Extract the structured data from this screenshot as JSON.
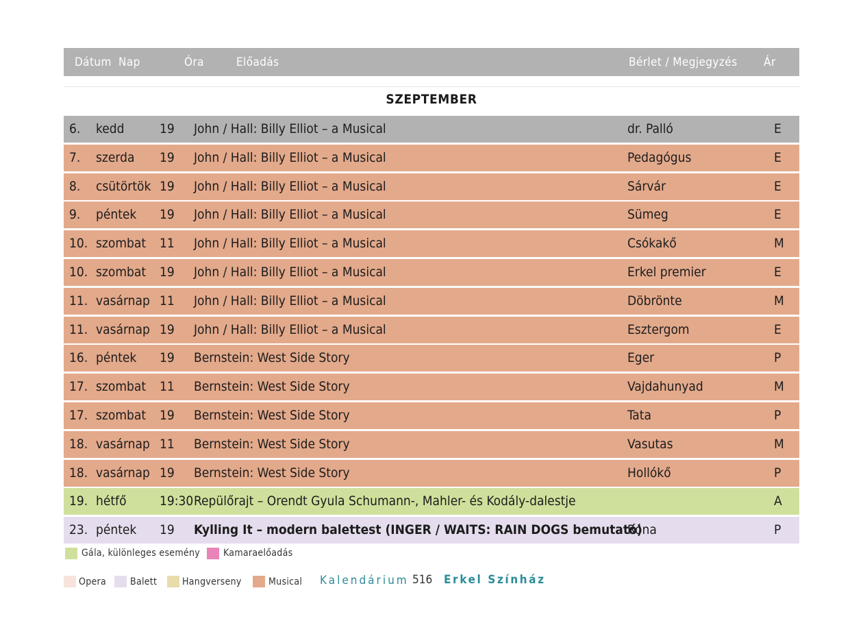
{
  "header": {
    "date": "Dátum",
    "day": "Nap",
    "time": "Óra",
    "performance": "Előadás",
    "subscription": "Bérlet / Megjegyzés",
    "price": "Ár"
  },
  "month": "SZEPTEMBER",
  "colors": {
    "header": "#b2b2b2",
    "grey_row": "#b2b2b2",
    "musical": "#e3a98b",
    "gala": "#cfe09c",
    "ballet": "#e5dded",
    "opera": "#f7e3dc",
    "concert": "#e8dcab",
    "chamber": "#e884b8",
    "accent_teal": "#2b8c98"
  },
  "rows": [
    {
      "date": "6.",
      "day": "kedd",
      "time": "19",
      "title": "John / Hall: Billy Elliot – a Musical",
      "note": "dr. Palló",
      "price": "E",
      "kind": "grey"
    },
    {
      "date": "7.",
      "day": "szerda",
      "time": "19",
      "title": "John / Hall: Billy Elliot – a Musical",
      "note": "Pedagógus",
      "price": "E",
      "kind": "musical"
    },
    {
      "date": "8.",
      "day": "csütörtök",
      "time": "19",
      "title": "John / Hall: Billy Elliot – a Musical",
      "note": "Sárvár",
      "price": "E",
      "kind": "musical"
    },
    {
      "date": "9.",
      "day": "péntek",
      "time": "19",
      "title": "John / Hall: Billy Elliot – a Musical",
      "note": "Sümeg",
      "price": "E",
      "kind": "musical"
    },
    {
      "date": "10.",
      "day": "szombat",
      "time": "11",
      "title": "John / Hall: Billy Elliot – a Musical",
      "note": "Csókakő",
      "price": "M",
      "kind": "musical"
    },
    {
      "date": "10.",
      "day": "szombat",
      "time": "19",
      "title": "John / Hall: Billy Elliot – a Musical",
      "note": "Erkel premier",
      "price": "E",
      "kind": "musical"
    },
    {
      "date": "11.",
      "day": "vasárnap",
      "time": "11",
      "title": "John / Hall: Billy Elliot – a Musical",
      "note": "Döbrönte",
      "price": "M",
      "kind": "musical"
    },
    {
      "date": "11.",
      "day": "vasárnap",
      "time": "19",
      "title": "John / Hall: Billy Elliot – a Musical",
      "note": "Esztergom",
      "price": "E",
      "kind": "musical"
    },
    {
      "date": "16.",
      "day": "péntek",
      "time": "19",
      "title": "Bernstein: West Side Story",
      "note": "Eger",
      "price": "P",
      "kind": "musical"
    },
    {
      "date": "17.",
      "day": "szombat",
      "time": "11",
      "title": "Bernstein: West Side Story",
      "note": "Vajdahunyad",
      "price": "M",
      "kind": "musical"
    },
    {
      "date": "17.",
      "day": "szombat",
      "time": "19",
      "title": "Bernstein: West Side Story",
      "note": "Tata",
      "price": "P",
      "kind": "musical"
    },
    {
      "date": "18.",
      "day": "vasárnap",
      "time": "11",
      "title": "Bernstein: West Side Story",
      "note": "Vasutas",
      "price": "M",
      "kind": "musical"
    },
    {
      "date": "18.",
      "day": "vasárnap",
      "time": "19",
      "title": "Bernstein: West Side Story",
      "note": "Hollókő",
      "price": "P",
      "kind": "musical"
    },
    {
      "date": "19.",
      "day": "hétfő",
      "time": "19:30",
      "title": "Repülőrajt – Orendt Gyula Schumann-, Mahler- és Kodály-dalestje",
      "note": "",
      "price": "A",
      "kind": "gala"
    },
    {
      "date": "23.",
      "day": "péntek",
      "time": "19",
      "title": "Kylling It – modern balettest (INGER / WAITS: RAIN DOGS bemutató)",
      "note": "Róna",
      "price": "P",
      "kind": "ballet",
      "bold": true
    }
  ],
  "legend": {
    "gala": "Gála, különleges esemény",
    "chamber": "Kamaraelőadás",
    "opera": "Opera",
    "ballet": "Balett",
    "concert": "Hangverseny",
    "musical": "Musical"
  },
  "footer": {
    "section": "Kalendárium",
    "page_number": "516",
    "venue": "Erkel Színház"
  }
}
